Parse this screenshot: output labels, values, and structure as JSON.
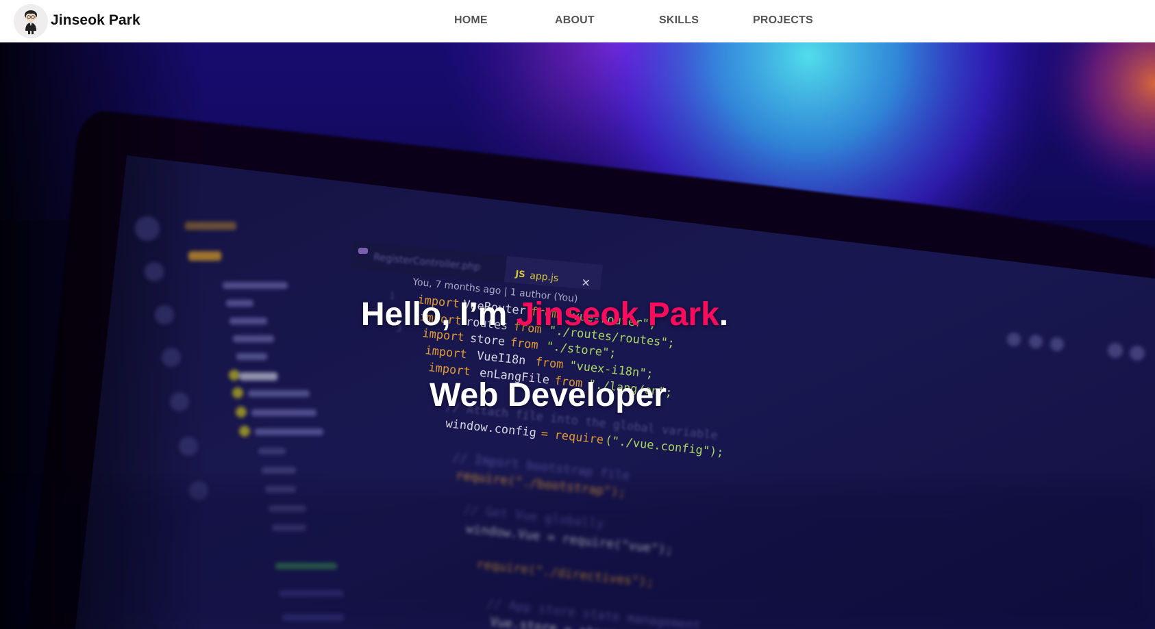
{
  "header": {
    "brand_name": "Jinseok Park",
    "nav": [
      {
        "label": "HOME"
      },
      {
        "label": "ABOUT"
      },
      {
        "label": "SKILLS"
      },
      {
        "label": "PROJECTS"
      }
    ]
  },
  "hero": {
    "greeting_prefix": "Hello, I’m ",
    "greeting_name": "Jinseok Park",
    "greeting_suffix": ".",
    "role": "Web Developer"
  },
  "background_code": {
    "tabs": [
      "RegisterController.php",
      "app.js"
    ],
    "blame": "You, 7 months ago | 1 author (You)",
    "lines": [
      "import VueRouter from \"vue-router\";",
      "import routes from \"./routes/routes\";",
      "import store from \"./store\";",
      "import VueI18n from \"vue-i18n\";",
      "import enLangFile from \"./lang/en\";",
      "// Attach file into the global variable",
      "window.config = require(\"./vue.config\");",
      "// Import bootstrap file",
      "require(\"./bootstrap\");",
      "// Get Vue globally",
      "window.Vue = require(\"vue\");",
      "require(\"./directives\");",
      "// App store state management",
      "Vue.store = store;"
    ]
  },
  "colors": {
    "accent": "#ff0b5e",
    "header_bg": "#ffffff",
    "nav_text": "#555555"
  }
}
